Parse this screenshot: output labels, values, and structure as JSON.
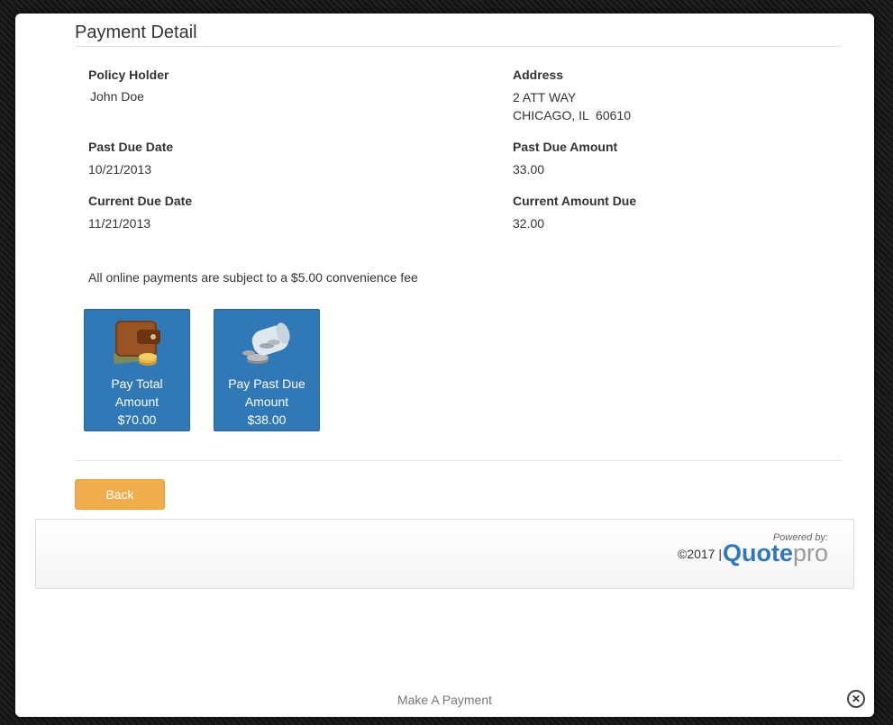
{
  "modal": {
    "title": "Payment Detail",
    "caption": "Make A Payment",
    "close_icon": "close-icon"
  },
  "details": {
    "policy_holder_label": "Policy Holder",
    "policy_holder_value": "John Doe",
    "address_label": "Address",
    "address_line1": "2 ATT WAY",
    "address_line2": "CHICAGO, IL  60610",
    "past_due_date_label": "Past Due Date",
    "past_due_date_value": "10/21/2013",
    "past_due_amount_label": "Past Due Amount",
    "past_due_amount_value": "33.00",
    "current_due_date_label": "Current Due Date",
    "current_due_date_value": "11/21/2013",
    "current_amount_due_label": "Current Amount Due",
    "current_amount_due_value": "32.00"
  },
  "fee_note": "All online payments are subject to a $5.00 convenience fee",
  "payment_options": [
    {
      "label_line1": "Pay Total",
      "label_line2": "Amount",
      "amount": "$70.00",
      "icon": "wallet-icon"
    },
    {
      "label_line1": "Pay Past Due",
      "label_line2": "Amount",
      "amount": "$38.00",
      "icon": "coin-jar-icon"
    }
  ],
  "back_label": "Back",
  "footer": {
    "copyright": "©2017 |",
    "powered_by": "Powered by:",
    "logo_primary": "Quote",
    "logo_secondary": "pro"
  },
  "colors": {
    "primary_button": "#3178b6",
    "back_button": "#f0ad4e",
    "logo_blue": "#2e78c0"
  }
}
